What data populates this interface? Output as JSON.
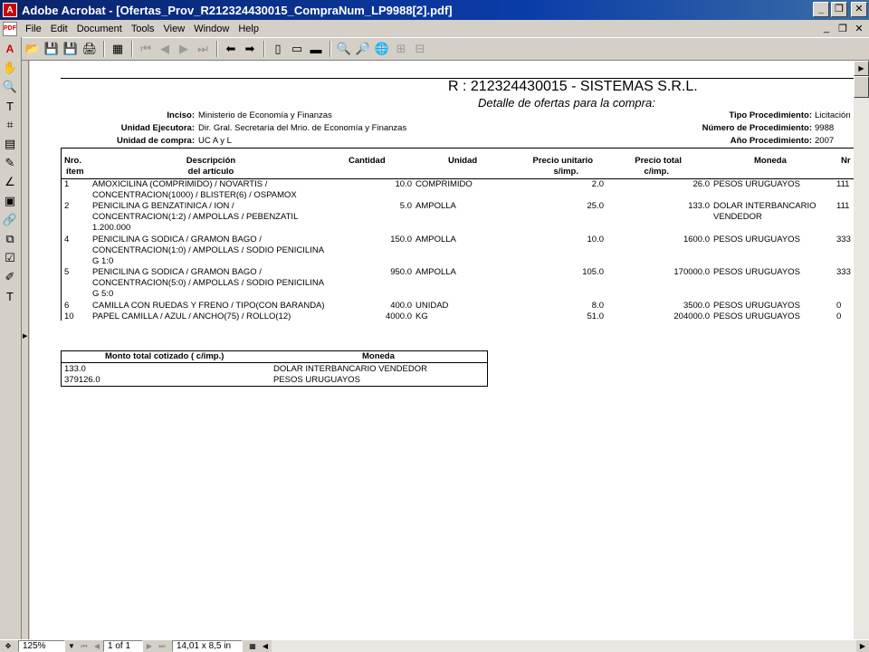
{
  "window": {
    "title": "Adobe Acrobat - [Ofertas_Prov_R212324430015_CompraNum_LP9988[2].pdf]",
    "app_icon": "A",
    "min_glyph": "_",
    "max_glyph": "❐",
    "close_glyph": "✕"
  },
  "menu": {
    "doc_icon": "PDF",
    "items": [
      "File",
      "Edit",
      "Document",
      "Tools",
      "View",
      "Window",
      "Help"
    ],
    "mdi_min": "_",
    "mdi_restore": "❐",
    "mdi_close": "✕"
  },
  "toolbar": {
    "open": "📂",
    "save": "💾",
    "print": "🖨",
    "email": "✉",
    "show_hide": "▦",
    "first": "⏮",
    "prev": "◀",
    "next": "▶",
    "last": "⏭",
    "back": "⬅",
    "forward": "➡",
    "actual": "▯",
    "fit_page": "▭",
    "fit_width": "▬",
    "find": "🔍",
    "search": "🔎",
    "web": "🌐",
    "web2": "⊞",
    "web3": "⊟"
  },
  "lefttools": {
    "acrobat": "A",
    "hand": "✋",
    "zoom": "🔍",
    "text_select": "T",
    "crop": "⌗",
    "note": "▤",
    "pencil": "✎",
    "line": "∠",
    "movie": "▣",
    "link": "🔗",
    "article": "⧉",
    "form": "☑",
    "touchup": "✐",
    "touchup_text": "T"
  },
  "status": {
    "zoom": "125%",
    "page": "1 of 1",
    "size": "14,01 x 8,5 in"
  },
  "scroll": {
    "up": "▲",
    "down": "▼",
    "right": "▶"
  },
  "pdf": {
    "header_r": "R : 212324430015 - SISTEMAS S.R.L.",
    "header_sub": "Detalle de ofertas para la compra:",
    "info_left": [
      {
        "label": "Inciso:",
        "value": "Ministerio de Economía y Finanzas"
      },
      {
        "label": "Unidad Ejecutora:",
        "value": "Dir. Gral. Secretaría del Mrio. de Economía y Finanzas"
      },
      {
        "label": "Unidad de compra:",
        "value": "UC A y L"
      }
    ],
    "info_right": [
      {
        "label": "Tipo Procedimiento:",
        "value": "Licitación"
      },
      {
        "label": "Número de Procedimiento:",
        "value": "9988"
      },
      {
        "label": "Año Procedimiento:",
        "value": "2007"
      }
    ],
    "columns": {
      "nro1": "Nro.",
      "nro2": "ítem",
      "desc1": "Descripción",
      "desc2": "del artículo",
      "cant": "Cantidad",
      "unidad": "Unidad",
      "pu1": "Precio unitario",
      "pu2": "s/imp.",
      "pt1": "Precio total",
      "pt2": "c/imp.",
      "moneda": "Moneda",
      "nr": "Nr"
    },
    "rows": [
      {
        "nro": "1",
        "desc": [
          "AMOXICILINA (COMPRIMIDO) / NOVARTIS /",
          "CONCENTRACION(1000) / BLISTER(6) / OSPAMOX"
        ],
        "cant": "10.0",
        "unidad": "COMPRIMIDO",
        "pu": "2.0",
        "pt": "26.0",
        "moneda": [
          "PESOS URUGUAYOS"
        ],
        "nr": "111"
      },
      {
        "nro": "2",
        "desc": [
          "PENICILINA G BENZATINICA / ION /",
          "CONCENTRACION(1:2) / AMPOLLAS / PEBENZATIL",
          "1.200.000"
        ],
        "cant": "5.0",
        "unidad": "AMPOLLA",
        "pu": "25.0",
        "pt": "133.0",
        "moneda": [
          "DOLAR INTERBANCARIO",
          "VENDEDOR"
        ],
        "nr": "111"
      },
      {
        "nro": "4",
        "desc": [
          "PENICILINA G SODICA / GRAMON BAGO /",
          "CONCENTRACION(1:0) / AMPOLLAS / SODIO PENICILINA",
          "G 1:0"
        ],
        "cant": "150.0",
        "unidad": "AMPOLLA",
        "pu": "10.0",
        "pt": "1600.0",
        "moneda": [
          "PESOS URUGUAYOS"
        ],
        "nr": "333"
      },
      {
        "nro": "5",
        "desc": [
          "PENICILINA G SODICA / GRAMON BAGO /",
          "CONCENTRACION(5:0) / AMPOLLAS / SODIO PENICILINA",
          "G 5:0"
        ],
        "cant": "950.0",
        "unidad": "AMPOLLA",
        "pu": "105.0",
        "pt": "170000.0",
        "moneda": [
          "PESOS URUGUAYOS"
        ],
        "nr": "333"
      },
      {
        "nro": "6",
        "desc": [
          "CAMILLA CON RUEDAS Y FRENO / TIPO(CON BARANDA)"
        ],
        "cant": "400.0",
        "unidad": "UNIDAD",
        "pu": "8.0",
        "pt": "3500.0",
        "moneda": [
          "PESOS URUGUAYOS"
        ],
        "nr": "0"
      },
      {
        "nro": "10",
        "desc": [
          "PAPEL CAMILLA / AZUL / ANCHO(75) / ROLLO(12)"
        ],
        "cant": "4000.0",
        "unidad": "KG",
        "pu": "51.0",
        "pt": "204000.0",
        "moneda": [
          "PESOS URUGUAYOS"
        ],
        "nr": "0"
      }
    ],
    "summary": {
      "col1": "Monto total cotizado ( c/imp.)",
      "col2": "Moneda",
      "rows": [
        {
          "monto": "133.0",
          "moneda": "DOLAR INTERBANCARIO VENDEDOR"
        },
        {
          "monto": "379126.0",
          "moneda": "PESOS URUGUAYOS"
        }
      ]
    }
  }
}
